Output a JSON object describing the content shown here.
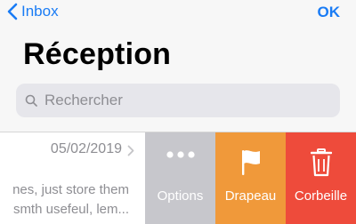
{
  "nav": {
    "back_label": "Inbox",
    "ok_label": "OK"
  },
  "header": {
    "title": "Réception"
  },
  "search": {
    "placeholder": "Rechercher"
  },
  "message": {
    "date": "05/02/2019",
    "preview_line1": "nes, just store them",
    "preview_line2": "smth usefeul, lem..."
  },
  "swipe_actions": [
    {
      "label": "Options",
      "icon": "more-icon",
      "color": "#c7c7cc"
    },
    {
      "label": "Drapeau",
      "icon": "flag-icon",
      "color": "#f0993a"
    },
    {
      "label": "Corbeille",
      "icon": "trash-icon",
      "color": "#ee4b3b"
    }
  ],
  "colors": {
    "accent": "#1a7cf5"
  }
}
